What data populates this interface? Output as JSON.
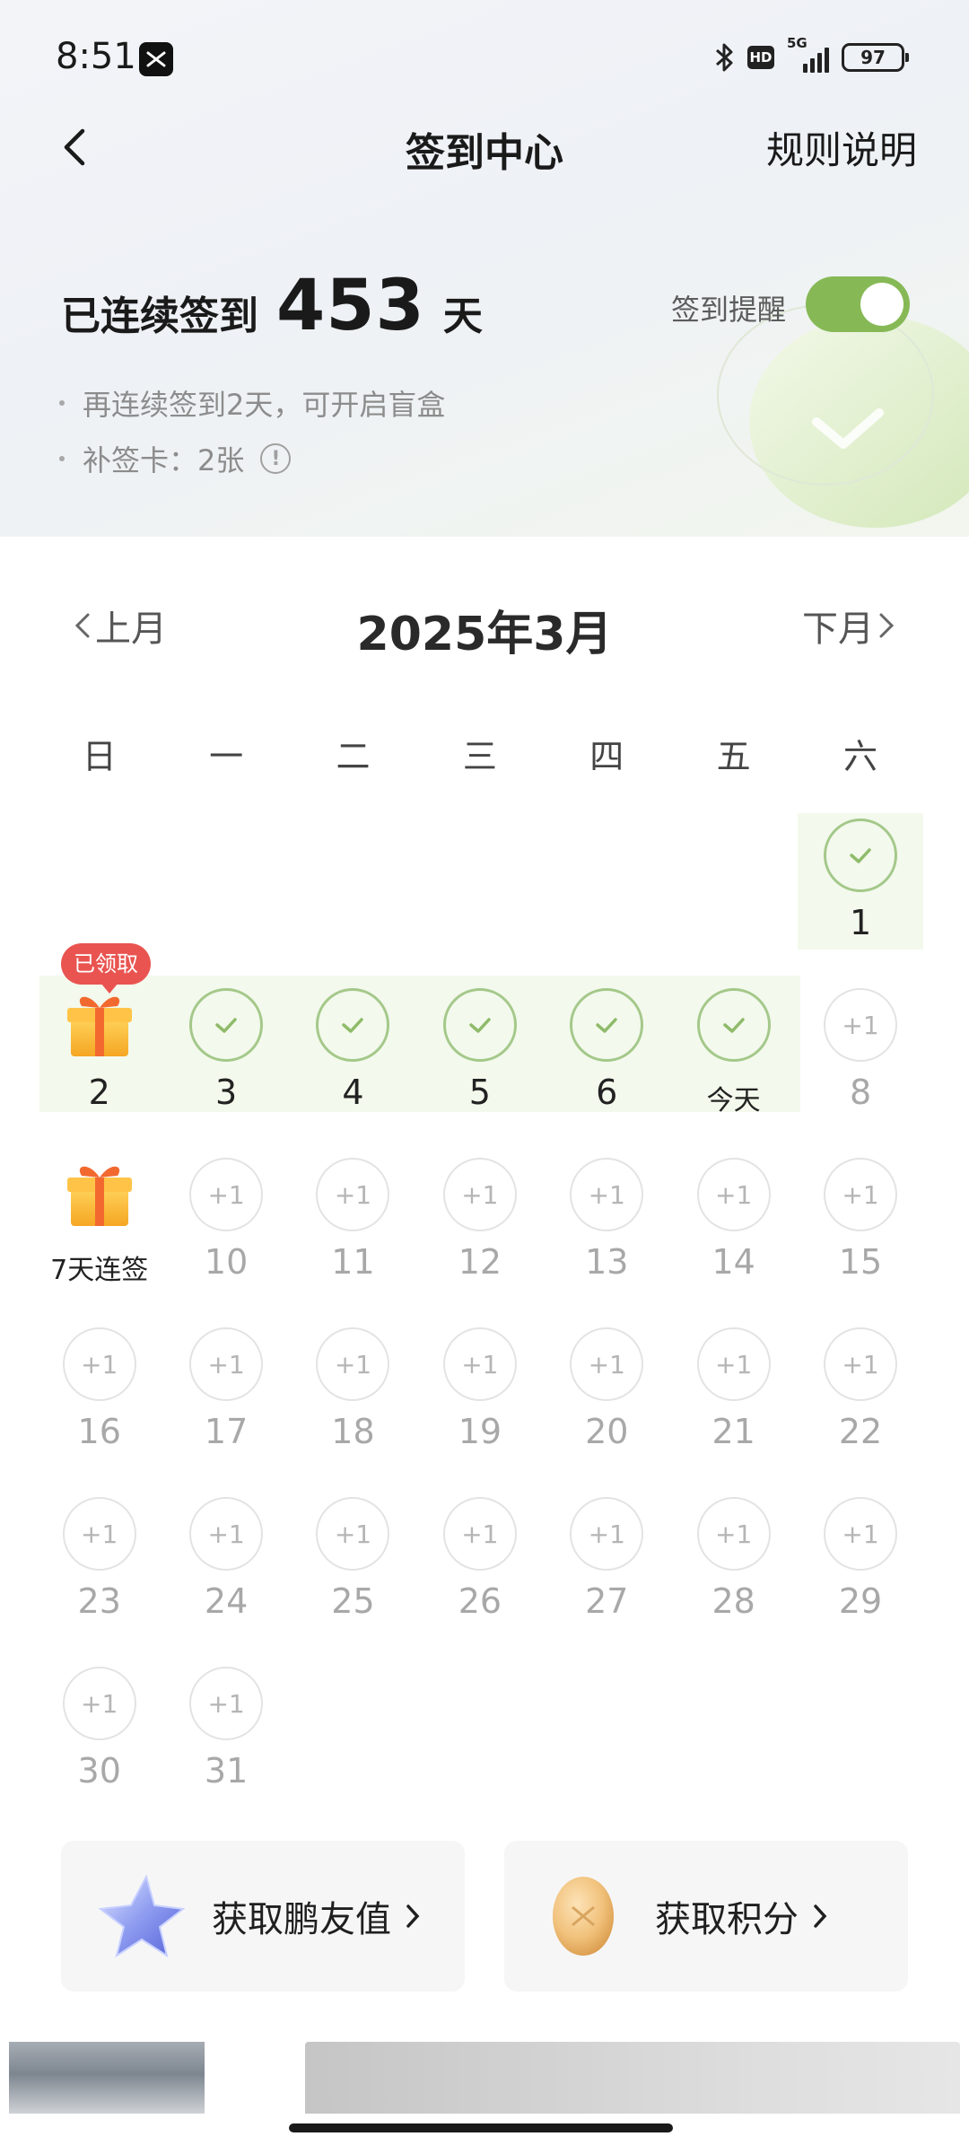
{
  "status_bar": {
    "time": "8:51",
    "network": "5G",
    "hd": "HD",
    "battery": "97"
  },
  "nav": {
    "title": "签到中心",
    "rules_label": "规则说明"
  },
  "streak": {
    "prefix": "已连续签到",
    "days": "453",
    "unit": "天"
  },
  "reminder": {
    "label": "签到提醒",
    "enabled": true,
    "color": "#86b956"
  },
  "hints": {
    "line1": "再连续签到2天，可开启盲盒",
    "line2": "补签卡：2张"
  },
  "calendar": {
    "prev_label": "上月",
    "next_label": "下月",
    "month_title": "2025年3月",
    "weekdays": [
      "日",
      "一",
      "二",
      "三",
      "四",
      "五",
      "六"
    ],
    "claimed_badge": "已领取",
    "today_label": "今天",
    "streak_gift_label": "7天连签",
    "future_label": "+1",
    "signed_days": [
      1,
      2,
      3,
      4,
      5,
      6
    ],
    "today": 7,
    "gift_days": [
      2,
      9
    ],
    "first_weekday": 6,
    "days_in_month": 31
  },
  "rewards": [
    {
      "label": "获取鹏友值",
      "icon": "blue-star-icon"
    },
    {
      "label": "获取积分",
      "icon": "gold-coin-icon"
    }
  ],
  "colors": {
    "done_circle": "#a4c88a",
    "check": "#8fbb6a",
    "highlight": "#f3f9ec",
    "badge": "#e95450"
  }
}
